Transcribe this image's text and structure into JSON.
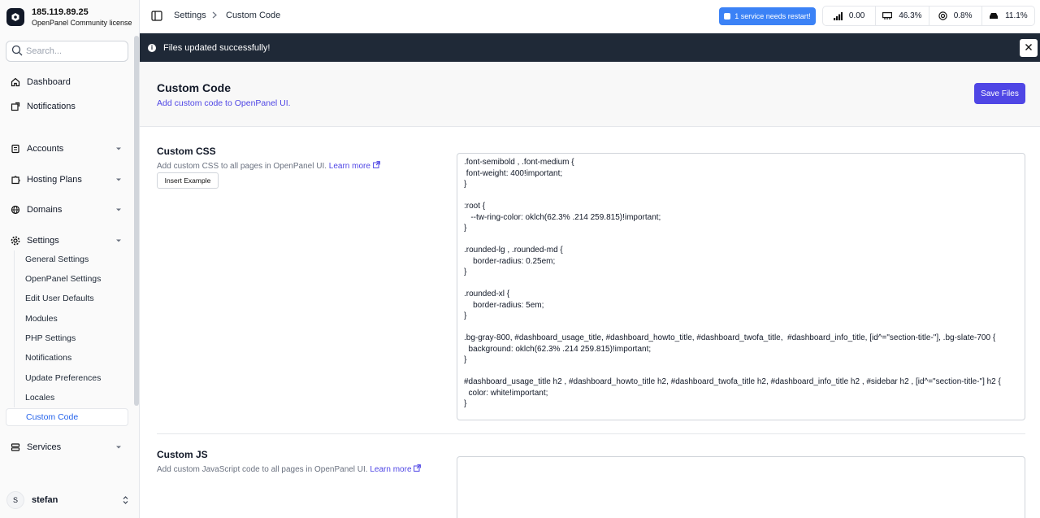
{
  "sidebar": {
    "brand_title": "185.119.89.25",
    "brand_subtitle": "OpenPanel Community license",
    "search_placeholder": "Search...",
    "items": [
      {
        "label": "Dashboard",
        "icon": "home-icon"
      },
      {
        "label": "Notifications",
        "icon": "external-link-icon"
      },
      {
        "label": "Accounts",
        "icon": "document-icon"
      },
      {
        "label": "Hosting Plans",
        "icon": "puzzle-icon"
      },
      {
        "label": "Domains",
        "icon": "globe-icon"
      },
      {
        "label": "Settings",
        "icon": "gear-icon"
      },
      {
        "label": "Services",
        "icon": "layers-icon"
      }
    ],
    "settings_sub": [
      "General Settings",
      "OpenPanel Settings",
      "Edit User Defaults",
      "Modules",
      "PHP Settings",
      "Notifications",
      "Update Preferences",
      "Locales",
      "Custom Code"
    ],
    "user_initial": "S",
    "user_name": "stefan"
  },
  "topbar": {
    "breadcrumb": [
      "Settings",
      "Custom Code"
    ],
    "restart_label": "1 service needs restart!",
    "stats": [
      {
        "icon": "load-bars-icon",
        "value": "0.00"
      },
      {
        "icon": "memory-icon",
        "value": "46.3%"
      },
      {
        "icon": "cpu-icon",
        "value": "0.8%"
      },
      {
        "icon": "disk-icon",
        "value": "11.1%"
      }
    ]
  },
  "alert": {
    "message": "Files updated successfully!"
  },
  "header": {
    "title": "Custom Code",
    "subtitle": "Add custom code to OpenPanel UI.",
    "save_label": "Save Files"
  },
  "css_section": {
    "title": "Custom CSS",
    "description": "Add custom CSS to all pages in OpenPanel UI.",
    "learn_more": "Learn more",
    "insert_label": "Insert Example",
    "code": ".font-semibold , .font-medium {\n font-weight: 400!important;\n}\n\n:root {\n   --tw-ring-color: oklch(62.3% .214 259.815)!important;\n}\n\n.rounded-lg , .rounded-md {\n    border-radius: 0.25em;\n}\n\n.rounded-xl {\n    border-radius: 5em;\n}\n\n.bg-gray-800, #dashboard_usage_title, #dashboard_howto_title, #dashboard_twofa_title,  #dashboard_info_title, [id^=\"section-title-\"], .bg-slate-700 {\n  background: oklch(62.3% .214 259.815)!important;\n}\n\n#dashboard_usage_title h2 , #dashboard_howto_title h2, #dashboard_twofa_title h2, #dashboard_info_title h2 , #sidebar h2 , [id^=\"section-title-\"] h2 {\n  color: white!important;\n}"
  },
  "js_section": {
    "title": "Custom JS",
    "description": "Add custom JavaScript code to all pages in OpenPanel UI.",
    "learn_more": "Learn more"
  }
}
